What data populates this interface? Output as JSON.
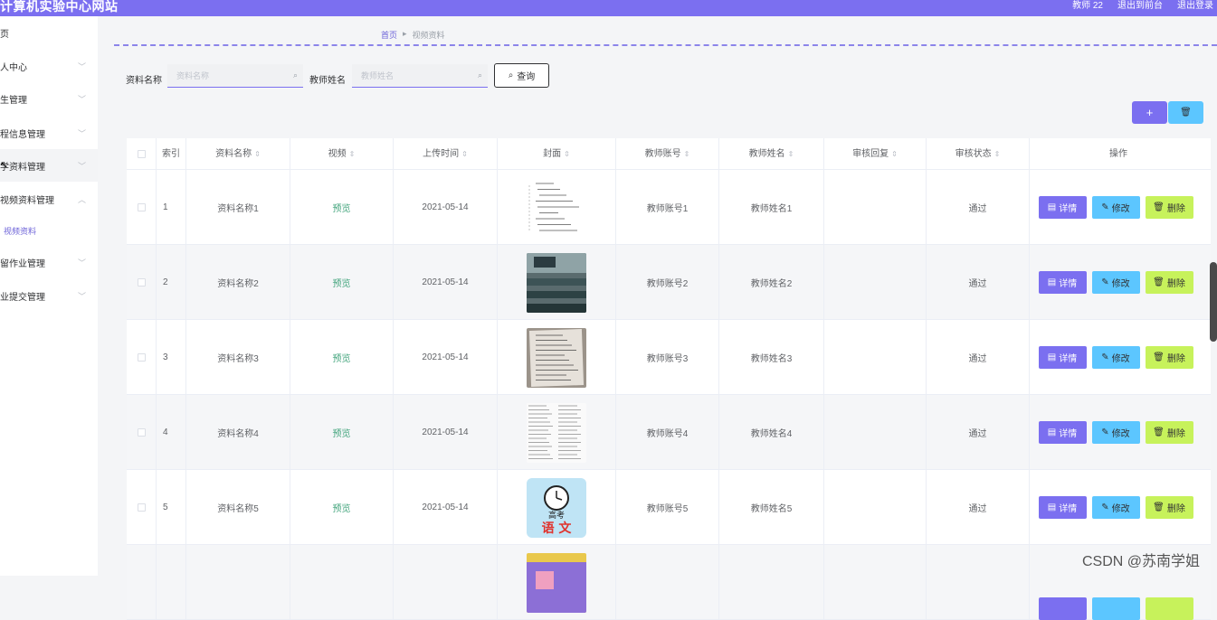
{
  "header": {
    "title": "计算机实验中心网站",
    "user": "教师 22",
    "to_frontend": "退出到前台",
    "logout": "退出登录"
  },
  "sidebar": {
    "items": [
      {
        "label": "页",
        "has_chevron": false
      },
      {
        "label": "人中心",
        "has_chevron": true
      },
      {
        "label": "生管理",
        "has_chevron": true
      },
      {
        "label": "程信息管理",
        "has_chevron": true
      },
      {
        "label": "学资料管理",
        "has_chevron": true
      },
      {
        "label": "视频资料管理",
        "has_chevron": true,
        "expanded": true
      },
      {
        "label": "留作业管理",
        "has_chevron": true
      },
      {
        "label": "业提交管理",
        "has_chevron": true
      }
    ],
    "sub_item": "视频资料"
  },
  "breadcrumb": {
    "home": "首页",
    "current": "视频资料"
  },
  "search": {
    "name_label": "资料名称",
    "name_placeholder": "资料名称",
    "teacher_label": "教师姓名",
    "teacher_placeholder": "教师姓名",
    "query_label": "查询"
  },
  "toolbar": {
    "add_label": "+",
    "delete_label": "🗑"
  },
  "table": {
    "headers": [
      "索引",
      "资料名称",
      "视频",
      "上传时间",
      "封面",
      "教师账号",
      "教师姓名",
      "审核回复",
      "审核状态",
      "操作"
    ],
    "rows": [
      {
        "index": "1",
        "name": "资料名称1",
        "video": "预览",
        "time": "2021-05-14",
        "cover": "doc-notes",
        "account": "教师账号1",
        "teacher": "教师姓名1",
        "reply": "",
        "status": "通过"
      },
      {
        "index": "2",
        "name": "资料名称2",
        "video": "预览",
        "time": "2021-05-14",
        "cover": "classroom",
        "account": "教师账号2",
        "teacher": "教师姓名2",
        "reply": "",
        "status": "通过"
      },
      {
        "index": "3",
        "name": "资料名称3",
        "video": "预览",
        "time": "2021-05-14",
        "cover": "paper",
        "account": "教师账号3",
        "teacher": "教师姓名3",
        "reply": "",
        "status": "通过"
      },
      {
        "index": "4",
        "name": "资料名称4",
        "video": "预览",
        "time": "2021-05-14",
        "cover": "exam-sheet",
        "account": "教师账号4",
        "teacher": "教师姓名4",
        "reply": "",
        "status": "通过"
      },
      {
        "index": "5",
        "name": "资料名称5",
        "video": "预览",
        "time": "2021-05-14",
        "cover": "chinese-book",
        "account": "教师账号5",
        "teacher": "教师姓名5",
        "reply": "",
        "status": "通过"
      },
      {
        "index": "",
        "name": "",
        "video": "",
        "time": "",
        "cover": "colorful",
        "account": "",
        "teacher": "",
        "reply": "",
        "status": ""
      }
    ],
    "actions": {
      "detail": "详情",
      "edit": "修改",
      "delete": "删除"
    }
  },
  "cover_texts": {
    "gaokao": "高考",
    "yuwen": "语 文"
  },
  "watermark": "CSDN @苏南学姐"
}
